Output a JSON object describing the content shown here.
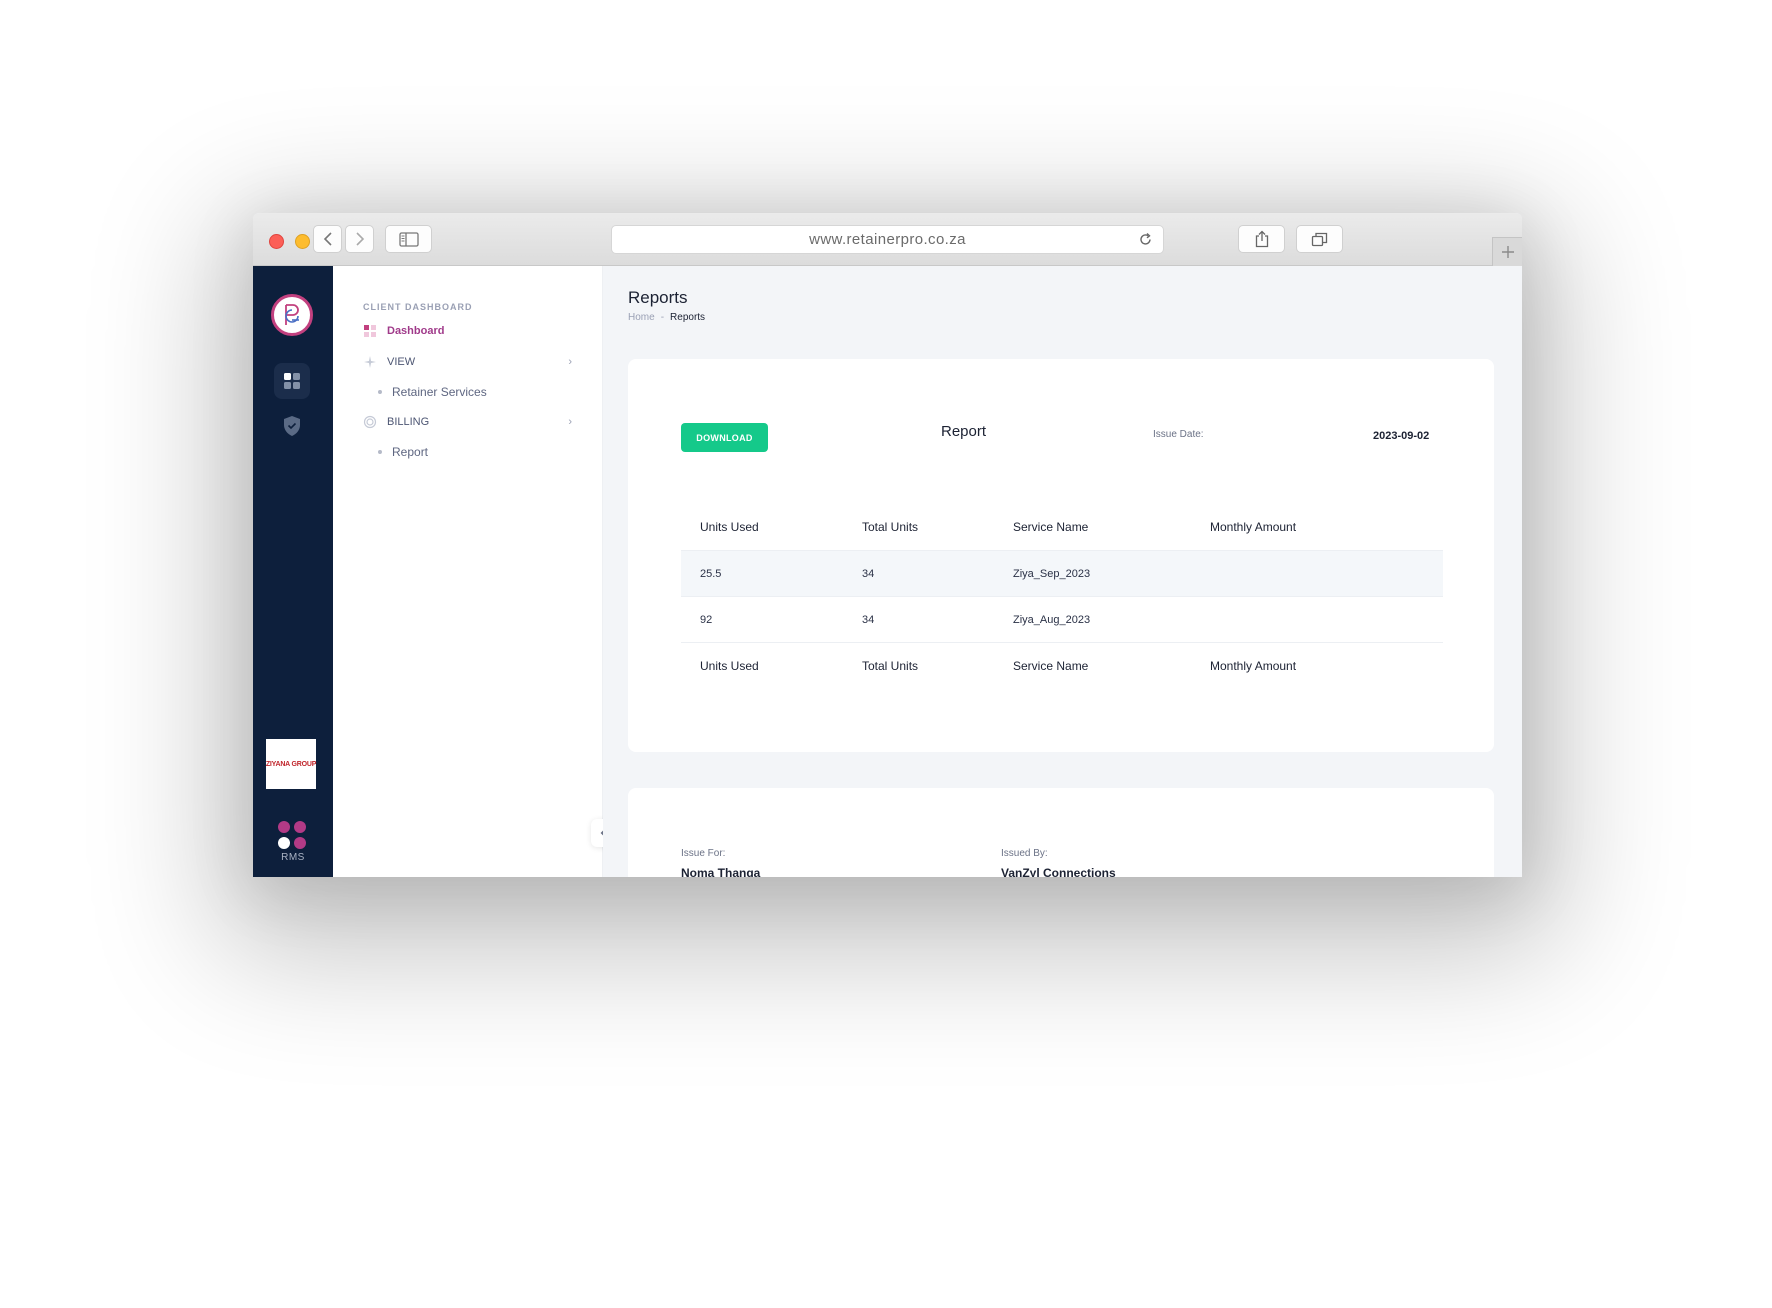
{
  "browser": {
    "url": "www.retainerpro.co.za"
  },
  "rail": {
    "company_logo_text": "ZIYANA GROUP",
    "brand_label": "RMS"
  },
  "menu": {
    "section_title": "CLIENT DASHBOARD",
    "items": [
      {
        "label": "Dashboard",
        "active": true,
        "icon": "dashboard-icon"
      },
      {
        "label": "VIEW",
        "icon": "view-icon",
        "children": [
          {
            "label": "Retainer Services"
          }
        ]
      },
      {
        "label": "BILLING",
        "icon": "billing-icon",
        "children": [
          {
            "label": "Report"
          }
        ]
      }
    ]
  },
  "page": {
    "title": "Reports",
    "breadcrumb": {
      "home": "Home",
      "separator": "-",
      "current": "Reports"
    }
  },
  "report": {
    "download_label": "DOWNLOAD",
    "title": "Report",
    "issue_date_label": "Issue Date:",
    "issue_date": "2023-09-02",
    "columns": [
      "Units Used",
      "Total Units",
      "Service Name",
      "Monthly Amount"
    ],
    "rows": [
      {
        "units_used": "25.5",
        "total_units": "34",
        "service_name": "Ziya_Sep_2023",
        "monthly_amount": ""
      },
      {
        "units_used": "92",
        "total_units": "34",
        "service_name": "Ziya_Aug_2023",
        "monthly_amount": ""
      }
    ]
  },
  "issue": {
    "for_label": "Issue For:",
    "for_value": "Noma Thanga",
    "by_label": "Issued By:",
    "by_value": "VanZyl Connections"
  },
  "colors": {
    "rail": "#0d1f3c",
    "accent": "#a03a8a",
    "download": "#15c98a"
  }
}
